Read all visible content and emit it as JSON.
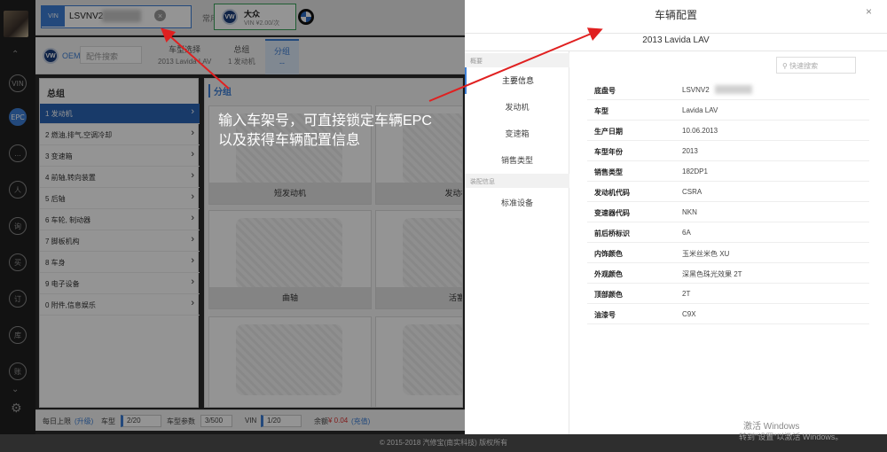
{
  "topbar": {
    "vin_tag": "VIN",
    "vin_value": "LSVNV2",
    "brand_label": "常用品牌",
    "vw_logo": "VW",
    "vw_name": "大众",
    "vw_price": "VIN ¥2.00/次"
  },
  "nav": {
    "oem_label": "OEM:",
    "oem_placeholder": "配件搜索",
    "tabs": [
      {
        "t": "车型选择",
        "s": "2013 Lavida LAV"
      },
      {
        "t": "总组",
        "s": "1 发动机"
      },
      {
        "t": "分组",
        "s": "--"
      }
    ]
  },
  "iconbar": {
    "icons": [
      "VIN",
      "EPC",
      "...",
      "人",
      "询",
      "买",
      "订",
      "库",
      "账"
    ]
  },
  "groups": {
    "title": "总组",
    "items": [
      "1 发动机",
      "2 燃油,排气,空调冷却",
      "3 变速箱",
      "4 前轴,转向装置",
      "5 后轴",
      "6 车轮, 制动器",
      "7 脚板机构",
      "8 车身",
      "9 电子设备",
      "0 附件,信息娱乐"
    ]
  },
  "parts": {
    "title": "分组",
    "cards": [
      "短发动机",
      "发动机",
      "曲轴",
      "活塞",
      "",
      ""
    ]
  },
  "annotation": {
    "line1": "输入车架号，可直接锁定车辆EPC",
    "line2": "以及获得车辆配置信息"
  },
  "status": {
    "daily": "每日上限",
    "upgrade": "(升级)",
    "model": "车型",
    "model_val": "2/20",
    "param": "车型参数",
    "param_val": "3/500",
    "vin": "VIN",
    "vin_val": "1/20",
    "balance": "余额",
    "balance_val": "¥ 0.04",
    "recharge": "(充值)"
  },
  "footer": "© 2015-2018 汽修宝(南实科技) 版权所有",
  "panel": {
    "title": "车辆配置",
    "close": "×",
    "model": "2013 Lavida LAV",
    "search": "快速搜索",
    "sections": [
      "概要",
      "装配信息"
    ],
    "items": [
      "主要信息",
      "发动机",
      "变速箱",
      "销售类型",
      "标准设备"
    ],
    "rows": [
      [
        "底盘号",
        "LSVNV2"
      ],
      [
        "车型",
        "Lavida LAV"
      ],
      [
        "生产日期",
        "10.06.2013"
      ],
      [
        "车型年份",
        "2013"
      ],
      [
        "销售类型",
        "182DP1"
      ],
      [
        "发动机代码",
        "CSRA"
      ],
      [
        "变速器代码",
        "NKN"
      ],
      [
        "前后桥标识",
        "6A"
      ],
      [
        "内饰颜色",
        "玉米丝米色 XU"
      ],
      [
        "外观颜色",
        "深黑色珠光效果 2T"
      ],
      [
        "顶部颜色",
        "2T"
      ],
      [
        "油漆号",
        "C9X"
      ]
    ]
  },
  "watermark": {
    "main": "Bai du 经验",
    "sub": "jingyan.baidu.com",
    "win1": "激活 Windows",
    "win2": "转到\"设置\"以激活 Windows。"
  }
}
